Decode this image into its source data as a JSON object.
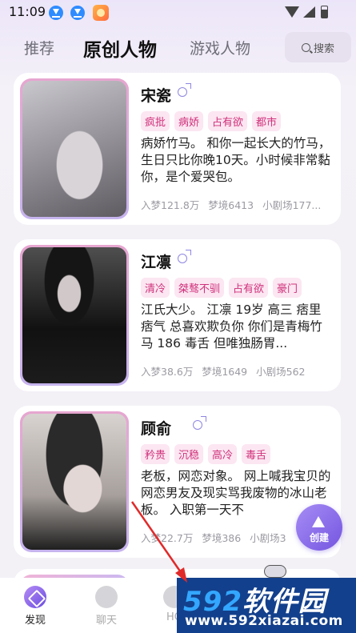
{
  "status_bar": {
    "time": "11:09"
  },
  "top_tabs": {
    "tabs": [
      {
        "label": "推荐",
        "active": false
      },
      {
        "label": "原创人物",
        "active": true
      },
      {
        "label": "游戏人物",
        "active": false
      }
    ],
    "search_label": "搜索"
  },
  "characters": [
    {
      "name": "宋瓷",
      "gender": "male",
      "tags": [
        "疯批",
        "病娇",
        "占有欲",
        "都市"
      ],
      "description": "病娇竹马。 和你一起长大的竹马，生日只比你晚10天。小时候非常黏你，是个爱哭包。",
      "stats": [
        "入梦121.8万",
        "梦境6413",
        "小剧场177..."
      ]
    },
    {
      "name": "江凛",
      "gender": "male",
      "tags": [
        "清冷",
        "桀骜不驯",
        "占有欲",
        "豪门"
      ],
      "description": "江氏大少。 江凛 19岁 高三 痞里痞气 总喜欢欺负你 你们是青梅竹马 186  毒舌 但唯独肠胃...",
      "stats": [
        "入梦38.6万",
        "梦境1649",
        "小剧场562"
      ]
    },
    {
      "name": "顾俞",
      "gender": "male",
      "tags": [
        "矜贵",
        "沉稳",
        "高冷",
        "毒舌"
      ],
      "description": "老板，网恋对象。 网上喊我宝贝的网恋男友及现实骂我废物的冰山老板。 入职第一天不",
      "stats": [
        "入梦22.7万",
        "梦境386",
        "小剧场3"
      ]
    }
  ],
  "create_button": {
    "label": "创建"
  },
  "bottom_nav": {
    "items": [
      {
        "label": "发现",
        "active": true
      },
      {
        "label": "聊天",
        "active": false
      },
      {
        "label": "HO",
        "active": false
      }
    ]
  },
  "watermark": {
    "line1_num": "592",
    "line1_text": "软件园",
    "line2": "www.592xiazai.com"
  },
  "colors": {
    "accent": "#7456e0",
    "tag_text": "#d0317b",
    "tag_bg": "#fbe6f1",
    "arrow": "#e02a2a"
  }
}
